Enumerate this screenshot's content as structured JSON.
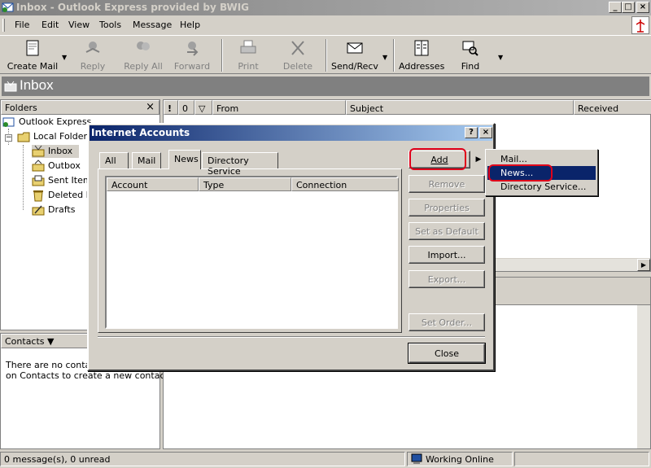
{
  "window": {
    "title": "Inbox - Outlook Express provided by BWIG"
  },
  "menu": [
    "File",
    "Edit",
    "View",
    "Tools",
    "Message",
    "Help"
  ],
  "toolbar": {
    "create_mail": "Create Mail",
    "reply": "Reply",
    "reply_all": "Reply All",
    "forward": "Forward",
    "print": "Print",
    "delete": "Delete",
    "send_recv": "Send/Recv",
    "addresses": "Addresses",
    "find": "Find"
  },
  "folder_header": {
    "title": "Inbox"
  },
  "folders": {
    "header": "Folders",
    "close": "×",
    "items": [
      "Outlook Express",
      "Local Folders",
      "Inbox",
      "Outbox",
      "Sent Items",
      "Deleted Items",
      "Drafts"
    ]
  },
  "contacts": {
    "header": "Contacts ▼",
    "line1": "There are no contacts to display. Click",
    "line2": "on Contacts to create a new contact."
  },
  "message_list": {
    "columns": [
      "!",
      "0",
      "▽",
      "From",
      "Subject",
      "Received"
    ]
  },
  "statusbar": {
    "messages": "0 message(s), 0 unread",
    "online": "Working Online"
  },
  "dialog": {
    "title": "Internet Accounts",
    "help_btn": "?",
    "close_btn": "×",
    "tabs": [
      "All",
      "Mail",
      "News",
      "Directory Service"
    ],
    "active_tab": "News",
    "columns": [
      "Account",
      "Type",
      "Connection"
    ],
    "buttons": {
      "add": "Add",
      "remove": "Remove",
      "properties": "Properties",
      "set_default": "Set as Default",
      "import": "Import...",
      "export": "Export...",
      "set_order": "Set Order...",
      "close": "Close"
    }
  },
  "popup_menu": {
    "items": [
      "Mail...",
      "News...",
      "Directory Service..."
    ],
    "selected": "News..."
  },
  "colors": {
    "highlight": "#0a246a",
    "annotation_red": "#e0001a"
  }
}
